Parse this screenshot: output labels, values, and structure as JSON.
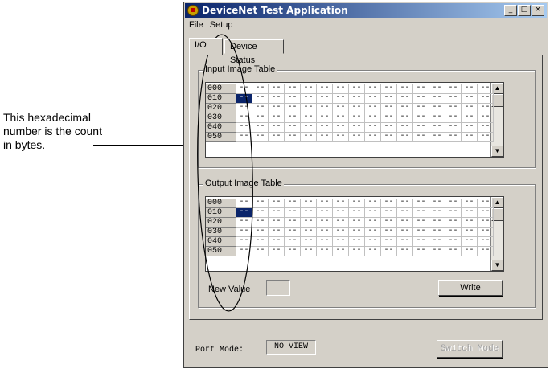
{
  "annotation": {
    "text": "This hexadecimal number is the count in bytes."
  },
  "window": {
    "title": "DeviceNet Test Application",
    "app_icon": "devicenet-app-icon",
    "controls": {
      "minimize": "_",
      "maximize": "□",
      "close": "×"
    }
  },
  "menu": [
    "File",
    "Setup"
  ],
  "tabs": [
    {
      "label": "I/O",
      "active": true
    },
    {
      "label": "Device Status",
      "active": false
    }
  ],
  "input_table": {
    "label": "Input Image Table",
    "rows": [
      "000",
      "010",
      "020",
      "030",
      "040",
      "050"
    ],
    "columns": 16,
    "cell_value": "--",
    "selected": {
      "row": 1,
      "col": 0
    }
  },
  "output_table": {
    "label": "Output Image Table",
    "rows": [
      "000",
      "010",
      "020",
      "030",
      "040",
      "050"
    ],
    "columns": 16,
    "cell_value": "--",
    "selected": {
      "row": 1,
      "col": 0
    }
  },
  "new_value": {
    "label": "New Value",
    "value": ""
  },
  "write_button": "Write",
  "port_mode": {
    "label": "Port Mode:",
    "value": "NO VIEW"
  },
  "switch_mode_button": {
    "label": "Switch Mode",
    "enabled": false
  },
  "colors": {
    "selection": "#0a246a",
    "title_bar": "#0a246a",
    "face": "#d4d0c8"
  }
}
